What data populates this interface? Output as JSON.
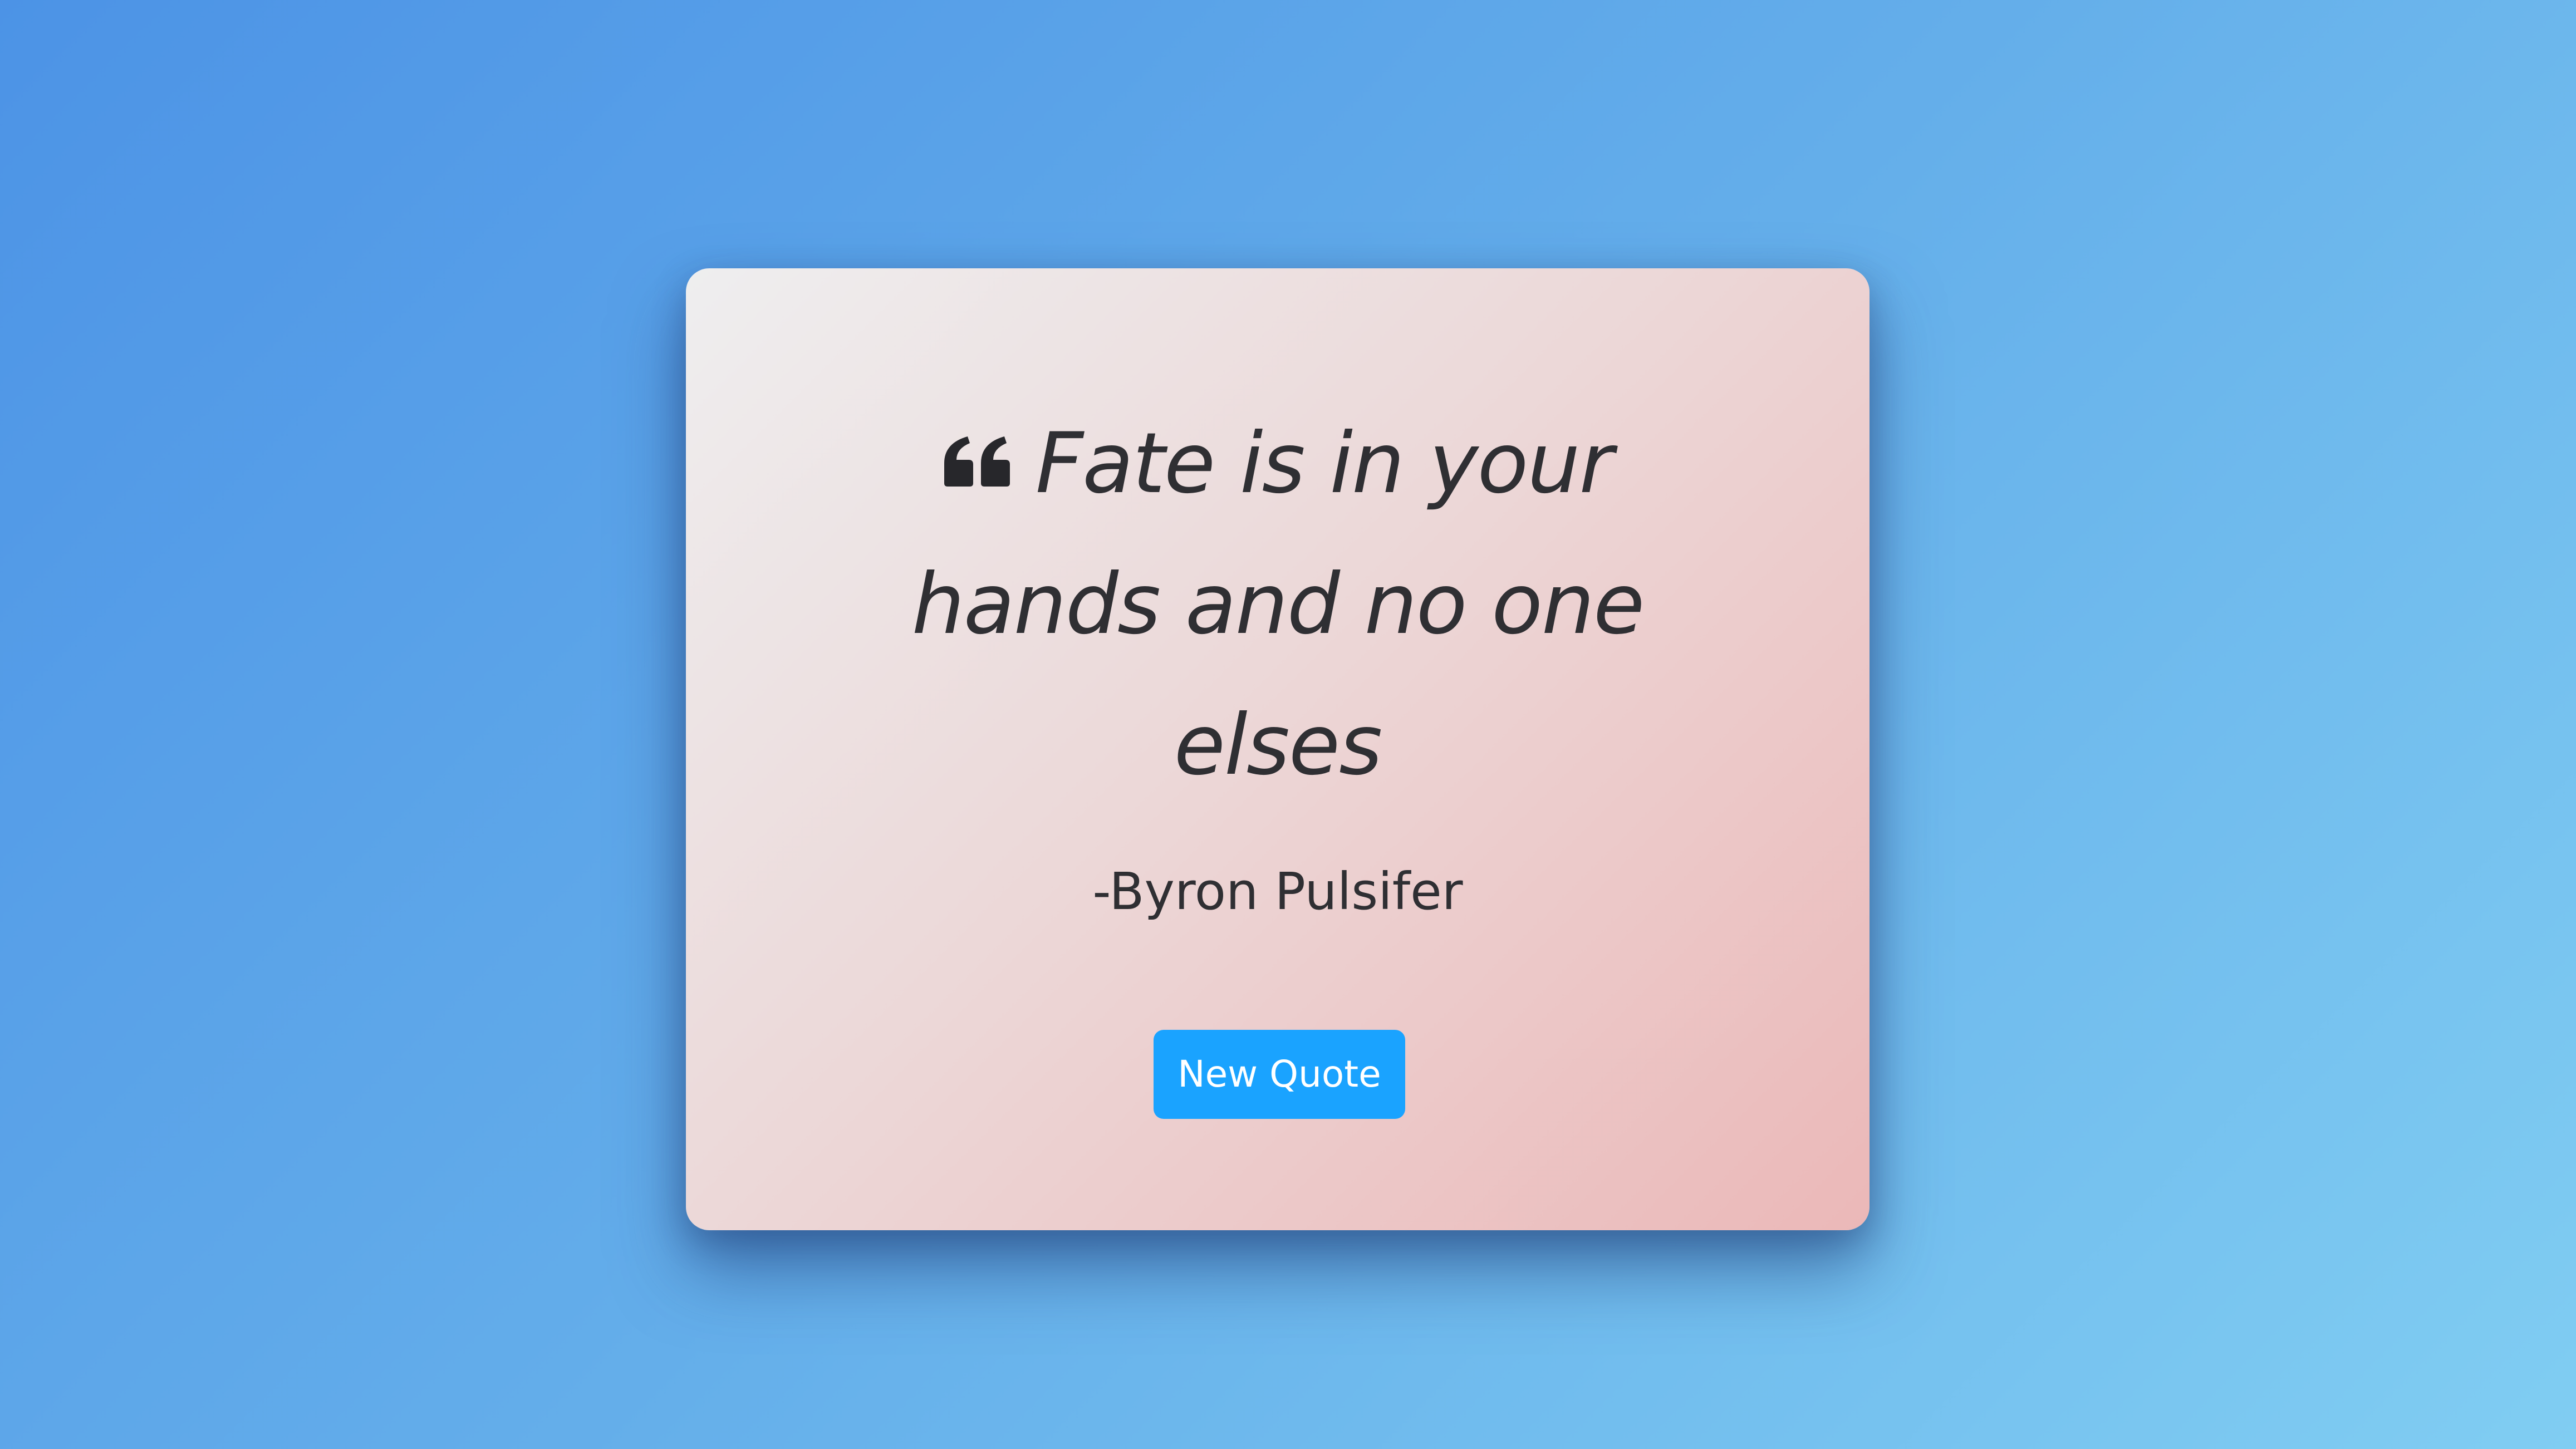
{
  "quote": {
    "icon": "quote-left-icon",
    "text": "Fate is in your hands and no one elses",
    "author": "-Byron Pulsifer"
  },
  "actions": {
    "new_quote_label": "New Quote"
  },
  "colors": {
    "button": "#1aa3ff",
    "text": "#2f2f33",
    "background_start": "#4c93e6",
    "background_end": "#80cdf2"
  }
}
